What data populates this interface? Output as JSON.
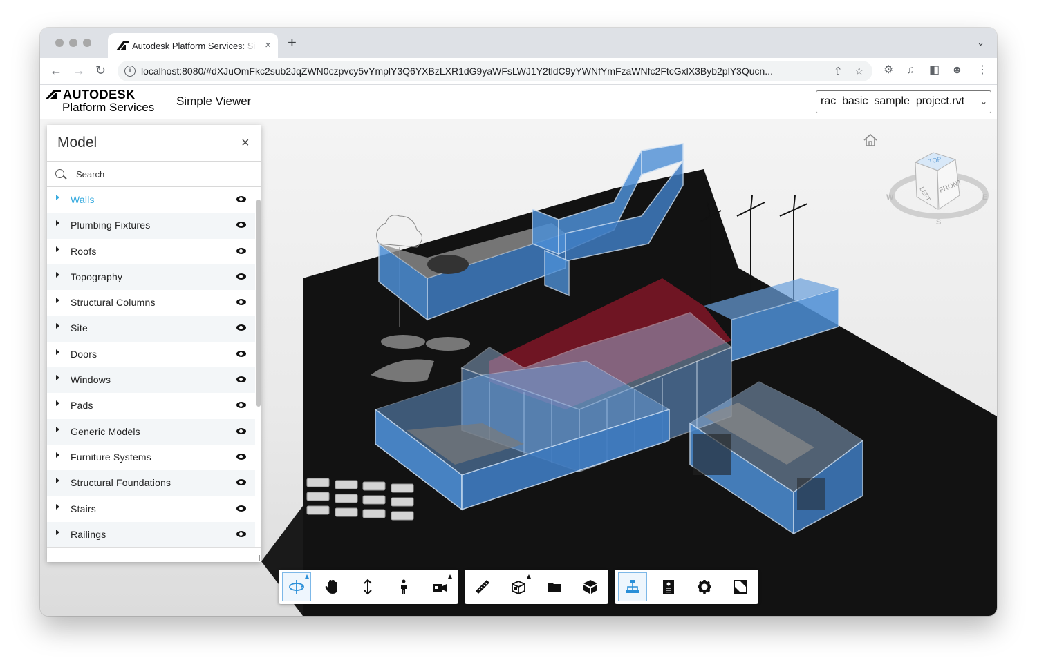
{
  "browser": {
    "tab_title": "Autodesk Platform Services: Simple Viewer",
    "tab_close": "×",
    "new_tab": "+",
    "url": "localhost:8080/#dXJuOmFkc2sub2JqZWN0czpvcy5vYmplY3Q6YXBzLXR1dG9yaWFsLWJ1Y2tldC9yYWNfYmFzaWNfc2FtcGxlX3Byb2plY3Qucn..."
  },
  "header": {
    "logo_line1": "AUTODESK",
    "logo_line2": "Platform Services",
    "app_title": "Simple Viewer",
    "model_select": {
      "selected": "rac_basic_sample_project.rvt"
    }
  },
  "model_panel": {
    "title": "Model",
    "close": "×",
    "search_placeholder": "Search",
    "items": [
      {
        "label": "Walls",
        "selected": true
      },
      {
        "label": "Plumbing Fixtures"
      },
      {
        "label": "Roofs"
      },
      {
        "label": "Topography"
      },
      {
        "label": "Structural Columns"
      },
      {
        "label": "Site"
      },
      {
        "label": "Doors"
      },
      {
        "label": "Windows"
      },
      {
        "label": "Pads"
      },
      {
        "label": "Generic Models"
      },
      {
        "label": "Furniture Systems"
      },
      {
        "label": "Structural Foundations"
      },
      {
        "label": "Stairs"
      },
      {
        "label": "Railings"
      }
    ]
  },
  "viewcube": {
    "top": "TOP",
    "left": "LEFT",
    "front": "FRONT",
    "west": "W",
    "east": "E",
    "south": "S"
  },
  "toolbar": {
    "groups": [
      {
        "tools": [
          "orbit-icon",
          "pan-icon",
          "zoom-icon",
          "first-person-icon",
          "camera-icon"
        ]
      },
      {
        "tools": [
          "measure-icon",
          "section-icon",
          "explode-icon",
          "model-browser-icon"
        ]
      },
      {
        "tools": [
          "model-tree-icon",
          "properties-icon",
          "settings-icon",
          "fullscreen-icon"
        ]
      }
    ]
  },
  "colors": {
    "accent": "#38abdf",
    "wall_blue": "#4d8fd6",
    "roof_red": "#8b1a2b",
    "ground": "#121212"
  }
}
